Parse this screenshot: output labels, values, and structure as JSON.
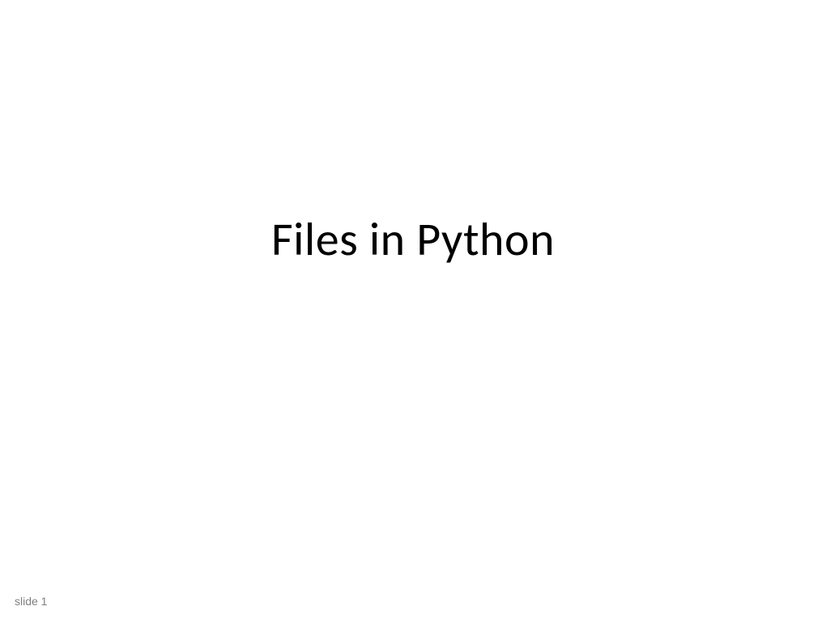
{
  "slide": {
    "title": "Files in Python",
    "footer": "slide 1"
  }
}
